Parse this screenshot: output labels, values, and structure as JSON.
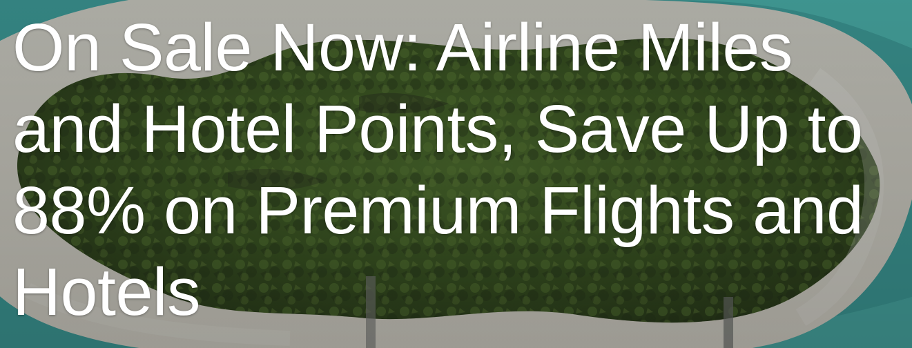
{
  "hero": {
    "headline": "On Sale Now: Airline Miles and Hotel Points, Save Up to 88% on Premium Flights and Hotels",
    "image_subject": "aerial-tropical-island-photo"
  },
  "colors": {
    "headline_text": "#ffffff",
    "foliage_dark": "#2b3a1d",
    "foliage_mid": "#4b6a2c",
    "sand": "#d8d4c8",
    "water": "#4fb7b2"
  }
}
